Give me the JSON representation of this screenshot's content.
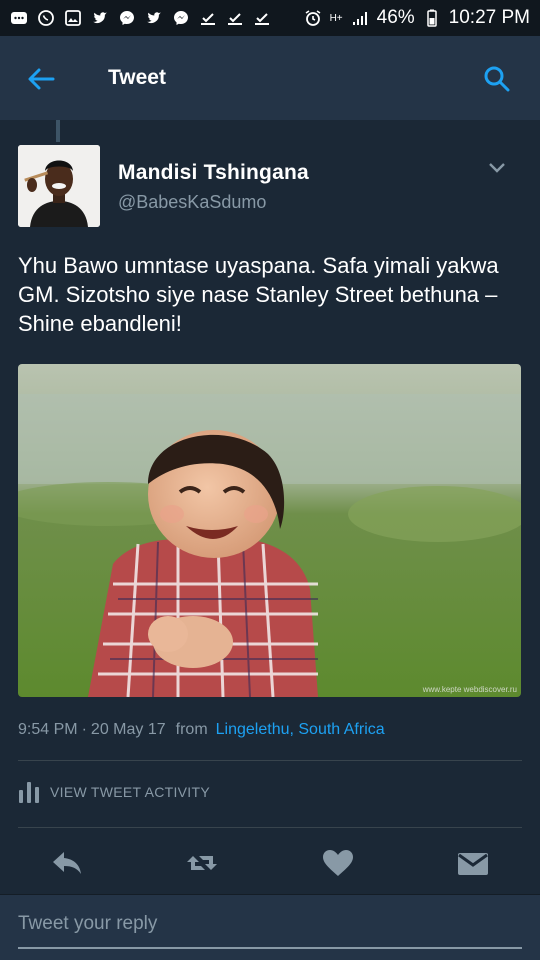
{
  "status_bar": {
    "battery": "46%",
    "time": "10:27 PM",
    "network": "H+"
  },
  "header": {
    "title": "Tweet"
  },
  "tweet": {
    "display_name": "Mandisi  Tshingana",
    "handle": "@BabesKaSdumo",
    "text": "Yhu Bawo umntase uyaspana. Safa yimali yakwa GM. Sizotsho siye nase Stanley Street bethuna – Shine ebandleni!",
    "media_watermark": "www.kepte",
    "media_watermark_2": "webdiscover.ru",
    "time": "9:54 PM",
    "separator": "·",
    "date": "20 May 17",
    "from_label": "from",
    "location": "Lingelethu, South Africa"
  },
  "activity": {
    "label": "VIEW TWEET ACTIVITY"
  },
  "reply": {
    "placeholder": "Tweet your reply"
  },
  "colors": {
    "background": "#1b2836",
    "header": "#243447",
    "accent": "#1da1f2",
    "muted": "#8899a6",
    "icon": "#8899a6"
  }
}
